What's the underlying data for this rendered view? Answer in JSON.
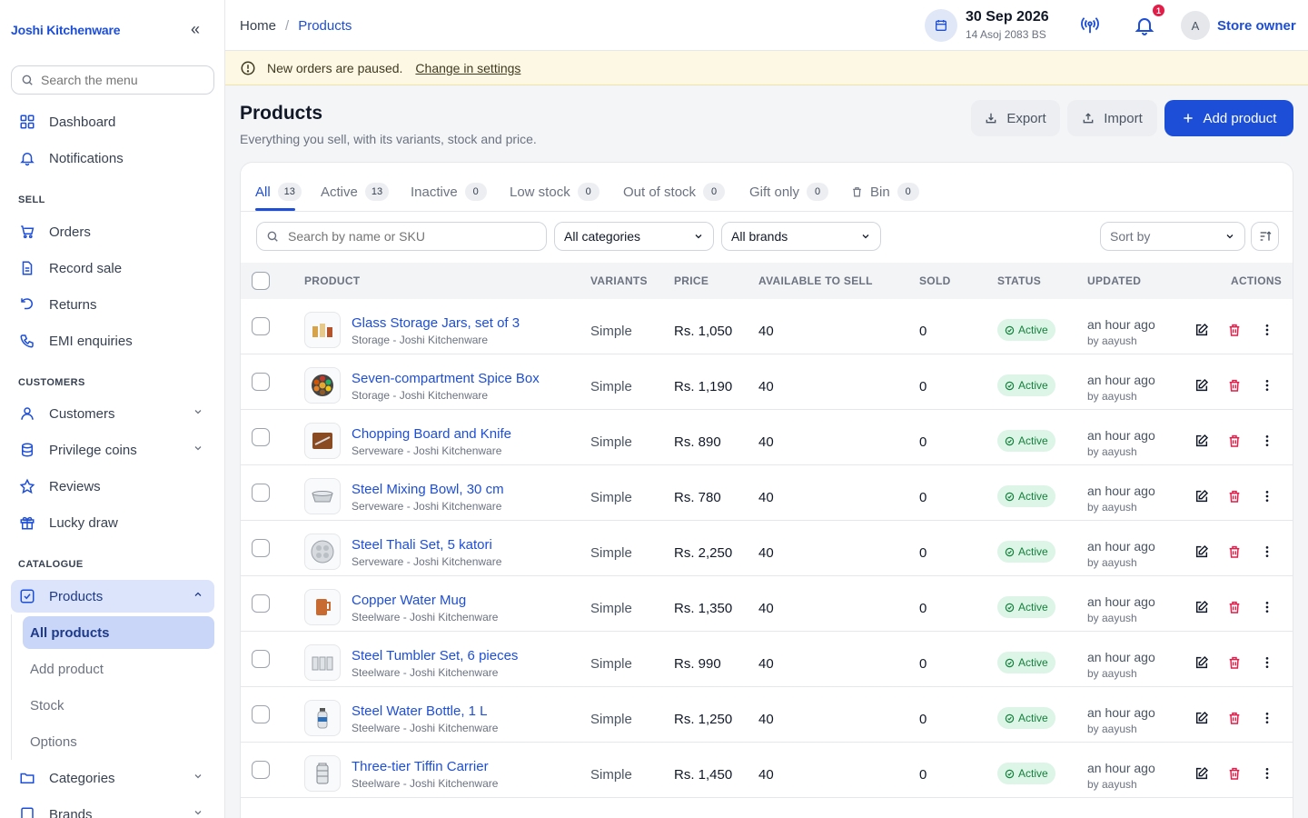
{
  "brand": "Joshi Kitchenware",
  "sidebar": {
    "search_placeholder": "Search the menu",
    "top_items": [
      {
        "label": "Dashboard",
        "icon": "dashboard-icon"
      },
      {
        "label": "Notifications",
        "icon": "bell-icon"
      }
    ],
    "sections": [
      "SELL",
      "CUSTOMERS",
      "CATALOGUE"
    ],
    "sell_items": [
      {
        "label": "Orders",
        "icon": "cart-icon"
      },
      {
        "label": "Record sale",
        "icon": "document-icon"
      },
      {
        "label": "Returns",
        "icon": "return-icon"
      },
      {
        "label": "EMI enquiries",
        "icon": "phone-icon"
      }
    ],
    "customer_items": [
      {
        "label": "Customers",
        "icon": "user-icon"
      },
      {
        "label": "Privilege coins",
        "icon": "coins-icon"
      },
      {
        "label": "Reviews",
        "icon": "star-icon"
      },
      {
        "label": "Lucky draw",
        "icon": "gift-icon"
      }
    ],
    "catalogue_items": [
      {
        "label": "Products",
        "icon": "checkbox-icon"
      },
      {
        "label": "Categories",
        "icon": "folder-icon"
      },
      {
        "label": "Brands",
        "icon": "tag-icon"
      }
    ],
    "product_sub_items": [
      "All products",
      "Add product",
      "Stock",
      "Options"
    ]
  },
  "header": {
    "breadcrumb": [
      "Home",
      "Products"
    ],
    "date": "30 Sep 2026",
    "date_bs": "14 Asoj 2083 BS",
    "notification_count": "1",
    "avatar_initial": "A",
    "user": "Store owner"
  },
  "banner": {
    "message": "New orders are paused.",
    "link": "Change in settings"
  },
  "page": {
    "title": "Products",
    "subtitle": "Everything you sell, with its variants, stock and price.",
    "export": "Export",
    "import": "Import",
    "add": "Add product"
  },
  "tabs": [
    {
      "label": "All",
      "count": "13"
    },
    {
      "label": "Active",
      "count": "13"
    },
    {
      "label": "Inactive",
      "count": "0"
    },
    {
      "label": "Low stock",
      "count": "0"
    },
    {
      "label": "Out of stock",
      "count": "0"
    },
    {
      "label": "Gift only",
      "count": "0"
    },
    {
      "label": "Bin",
      "count": "0"
    }
  ],
  "filters": {
    "search_placeholder": "Search by name or SKU",
    "category": "All categories",
    "brand": "All brands",
    "sort": "Sort by"
  },
  "table": {
    "columns": [
      "PRODUCT",
      "VARIANTS",
      "PRICE",
      "AVAILABLE TO SELL",
      "SOLD",
      "STATUS",
      "UPDATED",
      "ACTIONS"
    ],
    "rows": [
      {
        "name": "Glass Storage Jars, set of 3",
        "category": "Storage - Joshi Kitchenware",
        "variants": "Simple",
        "price": "Rs. 1,050",
        "available": "40",
        "sold": "0",
        "status": "Active",
        "updated": "an hour ago",
        "by": "by aayush"
      },
      {
        "name": "Seven-compartment Spice Box",
        "category": "Storage - Joshi Kitchenware",
        "variants": "Simple",
        "price": "Rs. 1,190",
        "available": "40",
        "sold": "0",
        "status": "Active",
        "updated": "an hour ago",
        "by": "by aayush"
      },
      {
        "name": "Chopping Board and Knife",
        "category": "Serveware - Joshi Kitchenware",
        "variants": "Simple",
        "price": "Rs. 890",
        "available": "40",
        "sold": "0",
        "status": "Active",
        "updated": "an hour ago",
        "by": "by aayush"
      },
      {
        "name": "Steel Mixing Bowl, 30 cm",
        "category": "Serveware - Joshi Kitchenware",
        "variants": "Simple",
        "price": "Rs. 780",
        "available": "40",
        "sold": "0",
        "status": "Active",
        "updated": "an hour ago",
        "by": "by aayush"
      },
      {
        "name": "Steel Thali Set, 5 katori",
        "category": "Serveware - Joshi Kitchenware",
        "variants": "Simple",
        "price": "Rs. 2,250",
        "available": "40",
        "sold": "0",
        "status": "Active",
        "updated": "an hour ago",
        "by": "by aayush"
      },
      {
        "name": "Copper Water Mug",
        "category": "Steelware - Joshi Kitchenware",
        "variants": "Simple",
        "price": "Rs. 1,350",
        "available": "40",
        "sold": "0",
        "status": "Active",
        "updated": "an hour ago",
        "by": "by aayush"
      },
      {
        "name": "Steel Tumbler Set, 6 pieces",
        "category": "Steelware - Joshi Kitchenware",
        "variants": "Simple",
        "price": "Rs. 990",
        "available": "40",
        "sold": "0",
        "status": "Active",
        "updated": "an hour ago",
        "by": "by aayush"
      },
      {
        "name": "Steel Water Bottle, 1 L",
        "category": "Steelware - Joshi Kitchenware",
        "variants": "Simple",
        "price": "Rs. 1,250",
        "available": "40",
        "sold": "0",
        "status": "Active",
        "updated": "an hour ago",
        "by": "by aayush"
      },
      {
        "name": "Three-tier Tiffin Carrier",
        "category": "Steelware - Joshi Kitchenware",
        "variants": "Simple",
        "price": "Rs. 1,450",
        "available": "40",
        "sold": "0",
        "status": "Active",
        "updated": "an hour ago",
        "by": "by aayush"
      }
    ]
  },
  "colors": {
    "accent": "#1d4ed8",
    "status_active_bg": "#dcf5e6",
    "status_active_text": "#15803d",
    "delete": "#e11d48",
    "banner_bg": "#fdf8e4"
  }
}
